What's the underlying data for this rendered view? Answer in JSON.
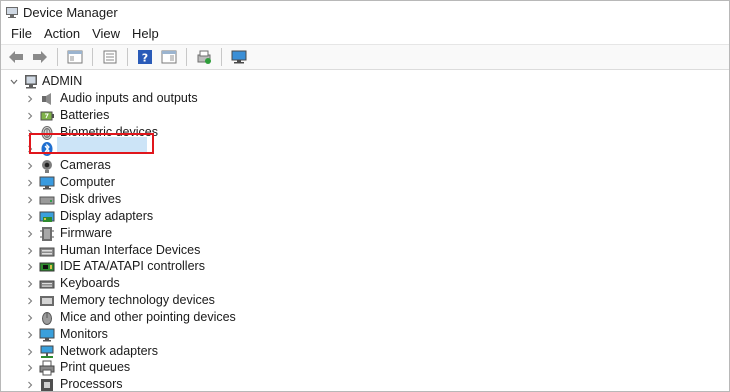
{
  "window": {
    "title": "Device Manager"
  },
  "menu": [
    "File",
    "Action",
    "View",
    "Help"
  ],
  "toolbar": {
    "buttons": [
      "back-icon",
      "forward-icon",
      "properties-pane-icon",
      "show-hide-console-tree-icon",
      "help-icon",
      "action-pane-icon",
      "update-driver-icon",
      "scan-hardware-icon"
    ]
  },
  "tree": {
    "root": "ADMIN",
    "items": [
      {
        "label": "Audio inputs and outputs",
        "icon": "speaker-icon"
      },
      {
        "label": "Batteries",
        "icon": "battery-icon"
      },
      {
        "label": "Biometric devices",
        "icon": "fingerprint-icon"
      },
      {
        "label": "Bluetooth",
        "icon": "bluetooth-icon"
      },
      {
        "label": "Cameras",
        "icon": "camera-icon"
      },
      {
        "label": "Computer",
        "icon": "computer-icon"
      },
      {
        "label": "Disk drives",
        "icon": "disk-drive-icon"
      },
      {
        "label": "Display adapters",
        "icon": "display-adapter-icon"
      },
      {
        "label": "Firmware",
        "icon": "firmware-icon"
      },
      {
        "label": "Human Interface Devices",
        "icon": "hid-icon"
      },
      {
        "label": "IDE ATA/ATAPI controllers",
        "icon": "ide-controller-icon"
      },
      {
        "label": "Keyboards",
        "icon": "keyboard-icon"
      },
      {
        "label": "Memory technology devices",
        "icon": "memory-icon"
      },
      {
        "label": "Mice and other pointing devices",
        "icon": "mouse-icon"
      },
      {
        "label": "Monitors",
        "icon": "monitor-icon"
      },
      {
        "label": "Network adapters",
        "icon": "network-adapter-icon"
      },
      {
        "label": "Print queues",
        "icon": "printer-icon"
      },
      {
        "label": "Processors",
        "icon": "processor-icon"
      }
    ]
  },
  "colors": {
    "highlight_box": "#e0161c",
    "selection": "#cce4f7"
  }
}
